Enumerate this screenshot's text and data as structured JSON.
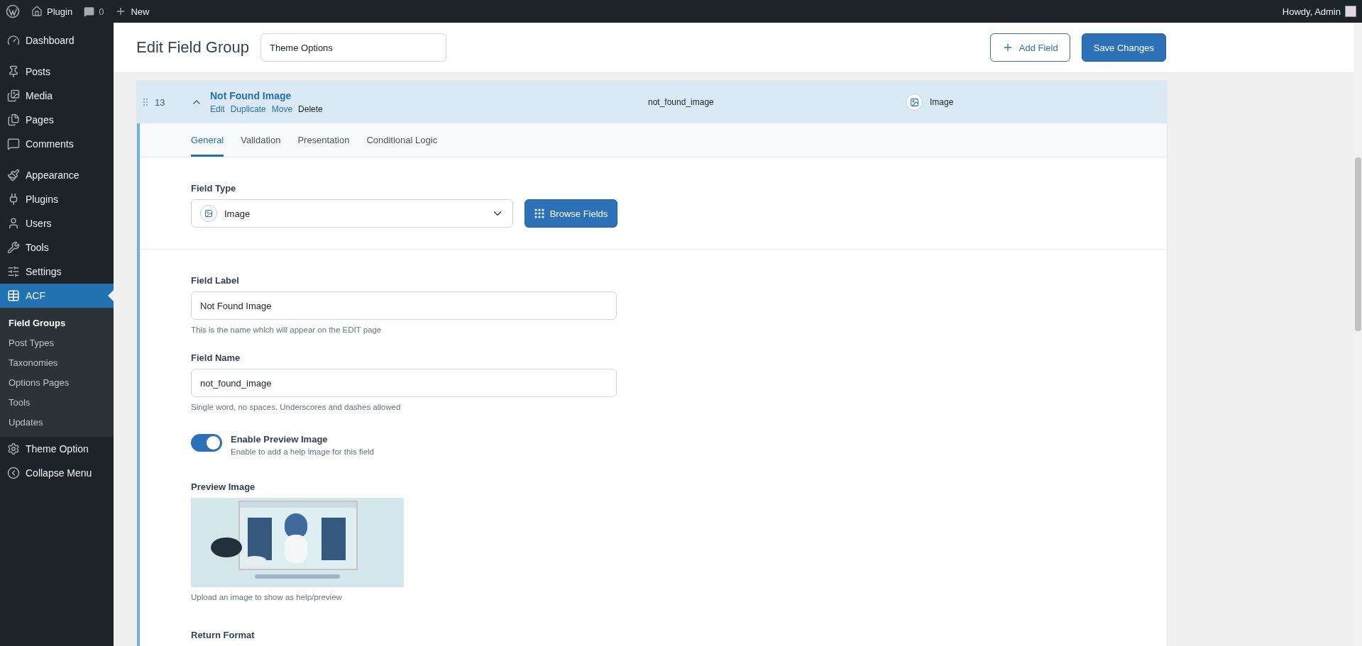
{
  "admin_bar": {
    "site": "Plugin",
    "comments": "0",
    "new": "New",
    "greeting": "Howdy, Admin"
  },
  "sidebar": {
    "sections": [
      {
        "items": [
          {
            "label": "Dashboard",
            "selected": false
          }
        ]
      },
      {
        "items": [
          {
            "label": "Posts",
            "selected": false
          },
          {
            "label": "Media",
            "selected": false
          },
          {
            "label": "Pages",
            "selected": false
          },
          {
            "label": "Comments",
            "selected": false
          }
        ]
      },
      {
        "items": [
          {
            "label": "Appearance",
            "selected": false
          },
          {
            "label": "Plugins",
            "selected": false
          },
          {
            "label": "Users",
            "selected": false
          },
          {
            "label": "Tools",
            "selected": false
          },
          {
            "label": "Settings",
            "selected": false
          },
          {
            "label": "ACF",
            "selected": true,
            "children": [
              {
                "label": "Field Groups",
                "selected": true
              },
              {
                "label": "Post Types",
                "selected": false
              },
              {
                "label": "Taxonomies",
                "selected": false
              },
              {
                "label": "Options Pages",
                "selected": false
              },
              {
                "label": "Tools",
                "selected": false
              },
              {
                "label": "Updates",
                "selected": false
              }
            ]
          },
          {
            "label": "Theme Option",
            "selected": false
          },
          {
            "label": "Collapse Menu",
            "selected": false
          }
        ]
      }
    ]
  },
  "header": {
    "title": "Edit Field Group",
    "group_title": "Theme Options",
    "buttons": [
      {
        "label": "Add Field",
        "kind": "secondary"
      },
      {
        "label": "Save Changes",
        "kind": "primary"
      }
    ]
  },
  "field_row": {
    "number": "13",
    "label": "Not Found Image",
    "expanded": true,
    "actions": [
      {
        "label": "Edit",
        "kind": "link"
      },
      {
        "label": "Duplicate",
        "kind": "link"
      },
      {
        "label": "Move",
        "kind": "link"
      },
      {
        "label": "Delete",
        "kind": "danger"
      }
    ],
    "name": "not_found_image",
    "type": "Image"
  },
  "tabs": [
    {
      "label": "General",
      "selected": true
    },
    {
      "label": "Validation",
      "selected": false
    },
    {
      "label": "Presentation",
      "selected": false
    },
    {
      "label": "Conditional Logic",
      "selected": false
    }
  ],
  "field_type": {
    "label": "Field Type",
    "value": "Image",
    "button": "Browse Fields"
  },
  "inputs": [
    {
      "label": "Field Label",
      "value": "Not Found Image",
      "help": "This is the name which will appear on the EDIT page"
    },
    {
      "label": "Field Name",
      "value": "not_found_image",
      "help": "Single word, no spaces. Underscores and dashes allowed"
    }
  ],
  "toggle": {
    "label": "Enable Preview Image",
    "description": "Enable to add a help image for this field",
    "on": true
  },
  "preview": {
    "label": "Preview Image",
    "help": "Upload an image to show as help/preview"
  },
  "next_setting": {
    "label": "Return Format"
  }
}
